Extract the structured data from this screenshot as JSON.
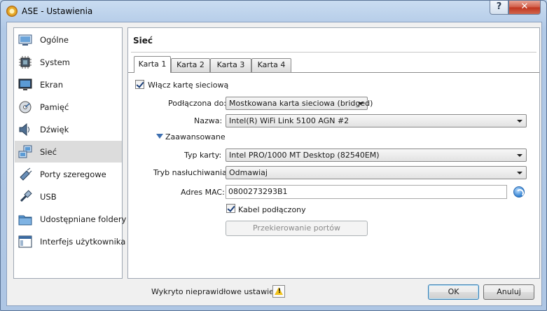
{
  "window": {
    "title": "ASE - Ustawienia",
    "help_label": "?",
    "close_label": "✕"
  },
  "sidebar": {
    "items": [
      {
        "label": "Ogólne",
        "icon": "monitor-icon"
      },
      {
        "label": "System",
        "icon": "chip-icon"
      },
      {
        "label": "Ekran",
        "icon": "display-icon"
      },
      {
        "label": "Pamięć",
        "icon": "disk-icon"
      },
      {
        "label": "Dźwięk",
        "icon": "speaker-icon"
      },
      {
        "label": "Sieć",
        "icon": "network-icon",
        "selected": true
      },
      {
        "label": "Porty szeregowe",
        "icon": "serial-port-icon"
      },
      {
        "label": "USB",
        "icon": "usb-icon"
      },
      {
        "label": "Udostępniane foldery",
        "icon": "folder-icon"
      },
      {
        "label": "Interfejs użytkownika",
        "icon": "ui-icon"
      }
    ]
  },
  "main": {
    "title": "Sieć",
    "tabs": [
      "Karta 1",
      "Karta 2",
      "Karta 3",
      "Karta 4"
    ],
    "active_tab": 0,
    "enable_adapter": {
      "label": "Włącz kartę sieciową",
      "checked": true
    },
    "attached_to": {
      "label": "Podłączona do:",
      "value": "Mostkowana karta sieciowa (bridged)"
    },
    "name": {
      "label": "Nazwa:",
      "value": "Intel(R) WiFi Link 5100 AGN #2"
    },
    "advanced": {
      "label": "Zaawansowane",
      "expanded": true
    },
    "adapter_type": {
      "label": "Typ karty:",
      "value": "Intel PRO/1000 MT Desktop (82540EM)"
    },
    "promiscuous": {
      "label": "Tryb nasłuchiwania:",
      "value": "Odmawiaj"
    },
    "mac": {
      "label": "Adres MAC:",
      "value": "0800273293B1"
    },
    "cable": {
      "label": "Kabel podłączony",
      "checked": true
    },
    "port_forwarding": {
      "label": "Przekierowanie portów"
    }
  },
  "footer": {
    "warning": "Wykryto nieprawidłowe ustawienia",
    "ok": "OK",
    "cancel": "Anuluj"
  },
  "colors": {
    "accent": "#3c7fb1",
    "selection": "#dcdcdc"
  }
}
